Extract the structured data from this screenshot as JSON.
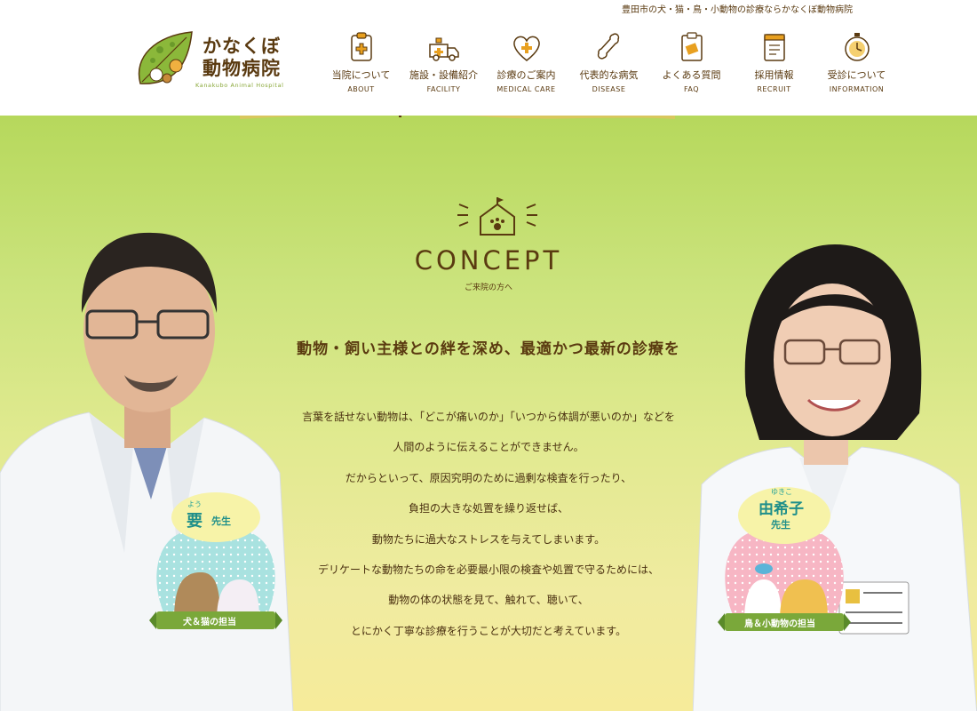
{
  "header": {
    "tagline": "豊田市の犬・猫・鳥・小動物の診療ならかなくぼ動物病院",
    "logo": {
      "name_line1": "かなくぼ",
      "name_line2": "動物病院",
      "sub": "Kanakubo Animal Hospital"
    },
    "nav": [
      {
        "jp": "当院について",
        "en": "ABOUT",
        "icon": "clipboard-cross-icon"
      },
      {
        "jp": "施設・設備紹介",
        "en": "FACILITY",
        "icon": "ambulance-icon"
      },
      {
        "jp": "診療のご案内",
        "en": "MEDICAL CARE",
        "icon": "heart-cross-icon"
      },
      {
        "jp": "代表的な病気",
        "en": "DISEASE",
        "icon": "bone-icon"
      },
      {
        "jp": "よくある質問",
        "en": "FAQ",
        "icon": "memo-icon"
      },
      {
        "jp": "採用情報",
        "en": "RECRUIT",
        "icon": "notebook-icon"
      },
      {
        "jp": "受診について",
        "en": "INFORMATION",
        "icon": "clock-icon"
      }
    ]
  },
  "concept": {
    "title": "CONCEPT",
    "subtitle": "ご来院の方へ",
    "headline": "動物・飼い主様との絆を深め、最適かつ最新の診療を",
    "lines": [
      "言葉を話せない動物は、「どこが痛いのか」「いつから体調が悪いのか」などを",
      "人間のように伝えることができません。",
      "だからといって、原因究明のために過剰な検査を行ったり、",
      "負担の大きな処置を繰り返せば、",
      "動物たちに過大なストレスを与えてしまいます。",
      "デリケートな動物たちの命を必要最小限の検査や処置で守るためには、",
      "動物の体の状態を見て、触れて、聴いて、",
      "とにかく丁寧な診療を行うことが大切だと考えています。"
    ]
  },
  "doctors": [
    {
      "ruby": "よう",
      "name": "要",
      "sensei": "先生",
      "role": "犬＆猫の担当"
    },
    {
      "ruby": "ゆきこ",
      "name": "由希子",
      "sensei": "先生",
      "role": "鳥＆小動物の担当"
    }
  ],
  "colors": {
    "brown": "#5a3a10",
    "green": "#b6d85c",
    "yellow": "#f6eb9a",
    "accent_orange": "#e8a020"
  }
}
